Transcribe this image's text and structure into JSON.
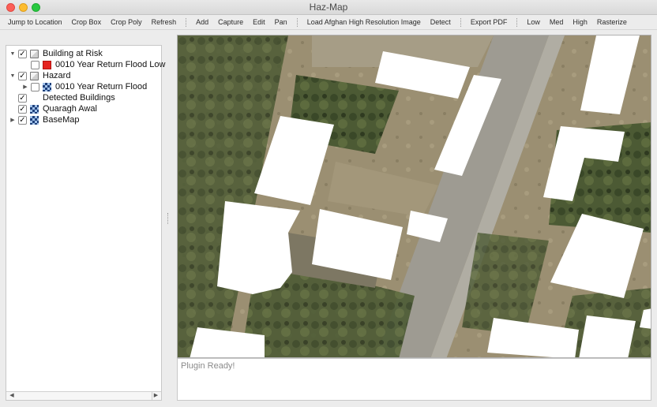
{
  "window": {
    "title": "Haz-Map"
  },
  "toolbar": {
    "groups": [
      [
        "Jump to Location",
        "Crop Box",
        "Crop Poly",
        "Refresh"
      ],
      [
        "Add",
        "Capture",
        "Edit",
        "Pan"
      ],
      [
        "Load Afghan High Resolution Image",
        "Detect"
      ],
      [
        "Export PDF"
      ],
      [
        "Low",
        "Med",
        "High",
        "Rasterize"
      ]
    ]
  },
  "layers": [
    {
      "label": "Building at Risk",
      "checked": true,
      "expand": "expanded",
      "indent": 0,
      "icon": "group-layer-icon"
    },
    {
      "label": "0010 Year Return Flood Low",
      "checked": false,
      "expand": "none",
      "indent": 1,
      "icon": "red-fill-icon",
      "color": "#e5231f"
    },
    {
      "label": "Hazard",
      "checked": true,
      "expand": "expanded",
      "indent": 0,
      "icon": "group-layer-icon"
    },
    {
      "label": "0010 Year Return Flood",
      "checked": false,
      "expand": "collapsed",
      "indent": 1,
      "icon": "raster-icon"
    },
    {
      "label": "Detected Buildings",
      "checked": true,
      "expand": "none",
      "indent": 0,
      "icon": "blank"
    },
    {
      "label": "Quaragh Awal",
      "checked": true,
      "expand": "none",
      "indent": 0,
      "icon": "raster-icon"
    },
    {
      "label": "BaseMap",
      "checked": true,
      "expand": "collapsed",
      "indent": 0,
      "icon": "raster-icon"
    }
  ],
  "log": {
    "text": "Plugin Ready!"
  }
}
